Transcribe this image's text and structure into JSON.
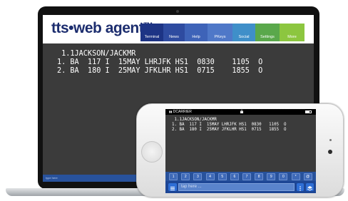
{
  "laptop": {
    "logo": {
      "text": "tts•web agent",
      "tm": "TM"
    },
    "tabs": [
      {
        "label": "Terminal",
        "color": "#1d3485"
      },
      {
        "label": "News",
        "color": "#2e4ba0"
      },
      {
        "label": "Help",
        "color": "#3e63b8"
      },
      {
        "label": "PKeys",
        "color": "#4f78c8"
      },
      {
        "label": "Social",
        "color": "#3f8fc9"
      },
      {
        "label": "Settings",
        "color": "#5aa84b"
      },
      {
        "label": "More",
        "color": "#8cc63f"
      }
    ],
    "terminal_lines": [
      " 1.1JACKSON/JACKMR",
      "1. BA  117 I  15MAY LHRJFK HS1  0830    1105  O",
      "2. BA  180 I  25MAY JFKLHR HS1  0715    1855  O"
    ],
    "status_text": "type here"
  },
  "phone": {
    "carrier": "DCARRIER",
    "terminal_lines": [
      " 1.1JACKSON/JACKMR",
      "1. BA  117 I  15MAY LHRJFK HS1  0830   1105  O",
      "2. BA  180 I  25MAY JFKLHR HS1  0715   1855  O"
    ],
    "keys": [
      "1",
      "2",
      "3",
      "4",
      "5",
      "6",
      "7",
      "8",
      "9",
      "0",
      "*",
      "@"
    ],
    "input_placeholder": "tap here ...",
    "icons": {
      "menu": "menu-icon",
      "more": "more-vertical-icon",
      "layers": "layers-icon",
      "lock": "lock-icon",
      "battery": "battery-icon"
    }
  }
}
